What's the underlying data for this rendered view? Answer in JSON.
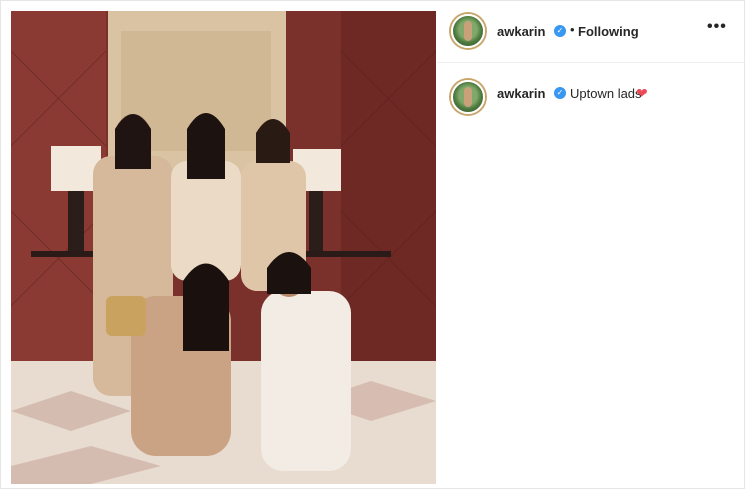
{
  "post": {
    "image_alt": "Five women posing in a hotel lobby with red walls and lamps",
    "author": {
      "username": "awkarin",
      "verified_icon": "verified-badge-icon",
      "follow_status": "Following",
      "separator": "•"
    },
    "more_options_label": "•••",
    "caption": {
      "username": "awkarin",
      "text": "Uptown lads",
      "emoji_icon": "red-heart-icon",
      "emoji": "❤"
    }
  },
  "colors": {
    "verified": "#3897f0",
    "heart": "#ed4956",
    "text": "#262626"
  }
}
